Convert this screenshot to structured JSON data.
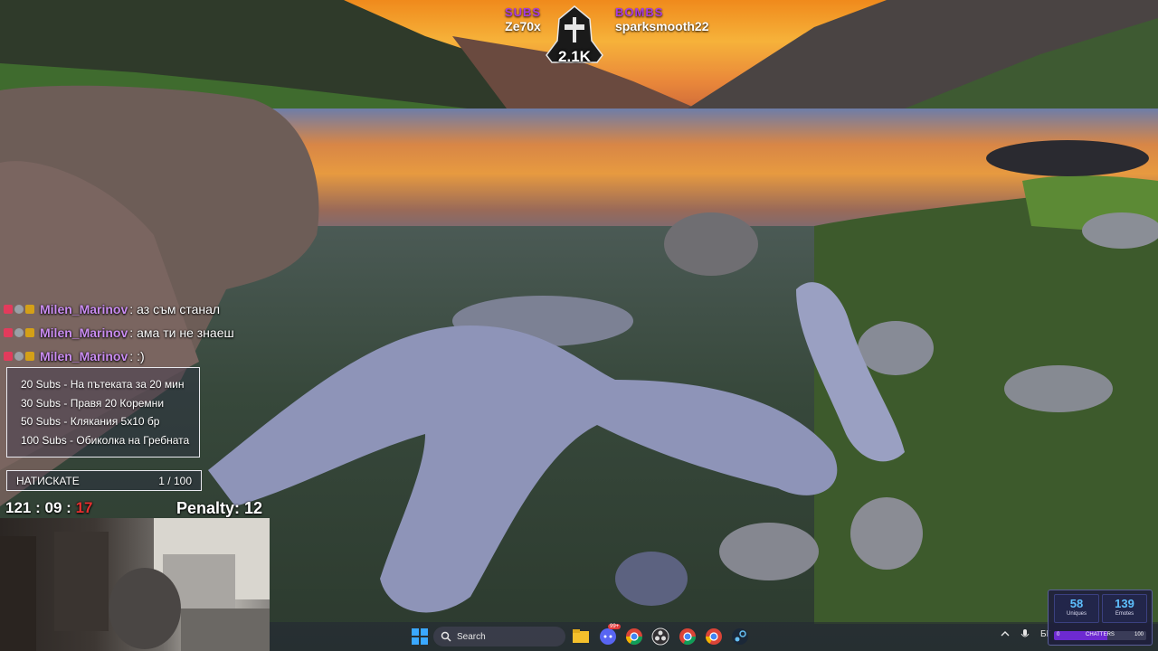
{
  "top_bar": {
    "subs_label": "SUBS",
    "subs_user": "Ze70x",
    "bombs_label": "BOMBS",
    "bombs_user": "sparksmooth22",
    "badge_count": "2.1K"
  },
  "chat": {
    "messages": [
      {
        "user": "Milen_Marinov",
        "sep": ":",
        "text": "аз съм станал"
      },
      {
        "user": "Milen_Marinov",
        "sep": ":",
        "text": "ама ти не знаеш"
      },
      {
        "user": "Milen_Marinov",
        "sep": ":",
        "text": ":)"
      }
    ]
  },
  "goals": {
    "items": [
      "20 Subs - На пътеката за 20 мин",
      "30 Subs - Правя 20 Коремни",
      "50 Subs - Клякания 5x10 бр",
      "100 Subs - Обиколка на Гребната"
    ]
  },
  "progress": {
    "label": "НАТИСКАТЕ",
    "count": "1 / 100"
  },
  "timer": {
    "hours": "121",
    "sep1": ":",
    "minutes": "09",
    "sep2": ":",
    "seconds": "17"
  },
  "penalty": {
    "text": "Penalty: 12"
  },
  "taskbar": {
    "search_placeholder": "Search",
    "discord_badge": "99+",
    "language": "БГ",
    "icons": [
      "windows-start",
      "search",
      "file-explorer",
      "discord",
      "chrome",
      "obs",
      "chrome-beta",
      "chrome-alt",
      "steam"
    ]
  },
  "stats": {
    "uniques_value": "58",
    "uniques_label": "Uniques",
    "emotes_value": "139",
    "emotes_label": "Emotes",
    "chatters_label": "CHATTERS",
    "chatters_min": "0",
    "chatters_max": "100",
    "chatters_fill": 0.58
  },
  "colors": {
    "accent_purple": "#a53be0",
    "username": "#c98cf0",
    "timer_red": "#e63030",
    "stats_blue": "#5ec0ff"
  }
}
